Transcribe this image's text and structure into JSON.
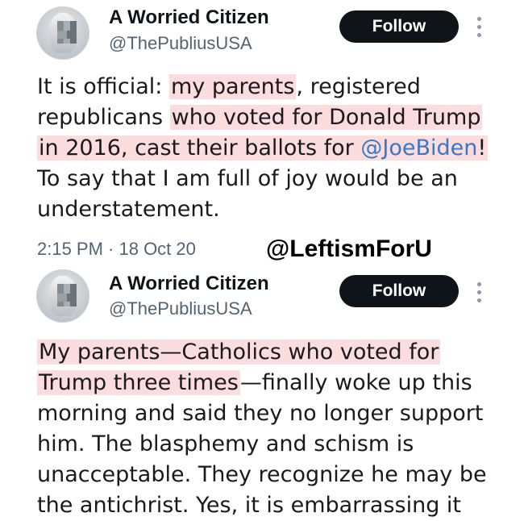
{
  "tweets": [
    {
      "author": {
        "name": "A Worried Citizen",
        "handle": "@ThePubliusUSA"
      },
      "follow_label": "Follow",
      "body": {
        "l1_a": "It is official: ",
        "l1_b": "my parents",
        "l1_c": ", registered",
        "l2_a": "republicans ",
        "l2_b": "who voted for Donald Trump",
        "l3_a": "in 2016, cast their ballots for ",
        "l3_mention": "@JoeBiden",
        "l3_c": "!",
        "l4": "To say that I am full of joy would be an",
        "l5": "understatement."
      },
      "timestamp": "2:15 PM · 18 Oct 20"
    },
    {
      "author": {
        "name": "A Worried Citizen",
        "handle": "@ThePubliusUSA"
      },
      "follow_label": "Follow",
      "body": {
        "l1": "My parents—Catholics who voted for",
        "l2_a": "Trump three times",
        "l2_b": "—finally woke up this",
        "l3": "morning and said they no longer support",
        "l4": "him.  The blasphemy and schism is",
        "l5": "unacceptable. They recognize he may be",
        "l6": "the antichrist. Yes, it is embarrassing it"
      }
    }
  ],
  "watermark": "@LeftismForU",
  "colors": {
    "highlight": "#fbdcdf",
    "mention": "#3b78c2",
    "button": "#0f1419"
  }
}
